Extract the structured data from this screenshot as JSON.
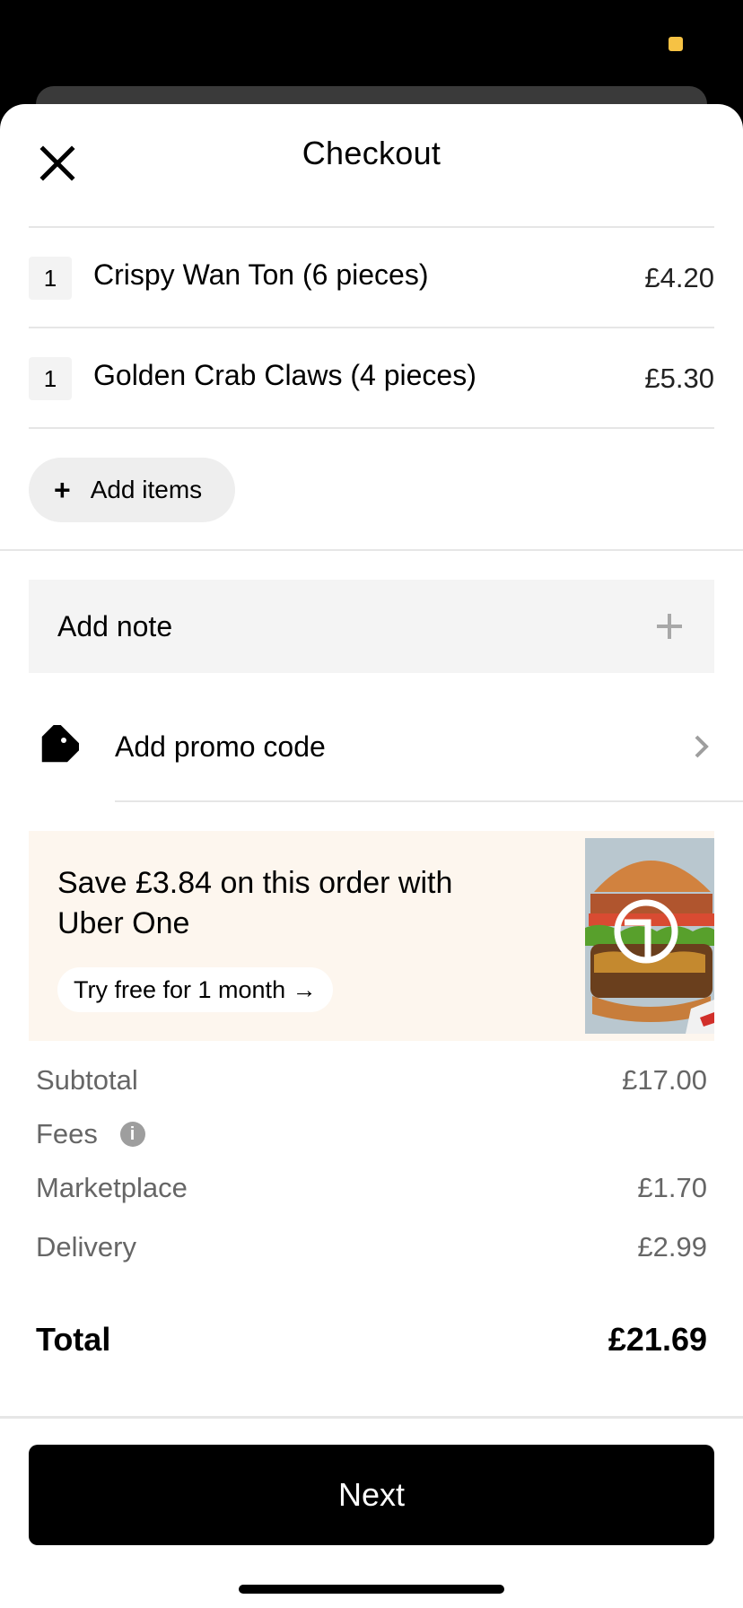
{
  "header": {
    "title": "Checkout"
  },
  "cart": {
    "items": [
      {
        "qty": "1",
        "name": "Crispy Wan Ton (6 pieces)",
        "price": "£4.20"
      },
      {
        "qty": "1",
        "name": "Golden Crab Claws (4 pieces)",
        "price": "£5.30"
      }
    ],
    "add_items_label": "Add items"
  },
  "note": {
    "label": "Add note"
  },
  "promo": {
    "label": "Add promo code"
  },
  "uber_one": {
    "headline": "Save £3.84 on this order with Uber One",
    "cta": "Try free for 1 month →"
  },
  "summary": {
    "subtotal_label": "Subtotal",
    "subtotal_value": "£17.00",
    "fees_label": "Fees",
    "marketplace_label": "Marketplace",
    "marketplace_value": "£1.70",
    "delivery_label": "Delivery",
    "delivery_value": "£2.99",
    "total_label": "Total",
    "total_value": "£21.69"
  },
  "footer": {
    "next_label": "Next"
  },
  "colors": {
    "status_dot": "#f6c244",
    "uber_one_bg": "#fdf6ee",
    "primary_button": "#000000"
  }
}
